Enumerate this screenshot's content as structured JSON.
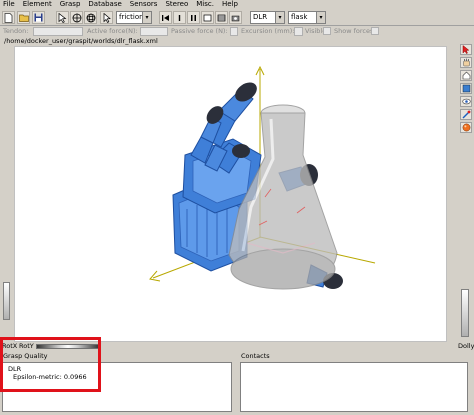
{
  "menu": [
    "File",
    "Element",
    "Grasp",
    "Database",
    "Sensors",
    "Stereo",
    "Misc.",
    "Help"
  ],
  "toolbar": {
    "contact_type": "frictionles",
    "hand": "DLR",
    "object": "flask"
  },
  "toolbar2": {
    "tendon_label": "Tendon:",
    "active_force_label": "Active force(N):",
    "passive_force_label": "Passive force (N):",
    "excursion_label": "Excursion (mm):",
    "visible_label": "Visible:",
    "show_forces_label": "Show forces:"
  },
  "path": "/home/docker_user/graspit/worlds/dlr_flask.xml",
  "status": {
    "rotx": "RotX",
    "roty": "RotY",
    "dolly": "Dolly"
  },
  "grasp_quality": {
    "title": "Grasp Quality",
    "hand": "DLR",
    "metric": "Epsilon-metric: 0.0966"
  },
  "contacts": {
    "title": "Contacts"
  },
  "colors": {
    "hand_blue": "#3f7fd8",
    "finger_tip": "#2b2f3a",
    "flask": "#b8b8b8",
    "axis": "#b8a800",
    "highlight": "#e0121a"
  }
}
